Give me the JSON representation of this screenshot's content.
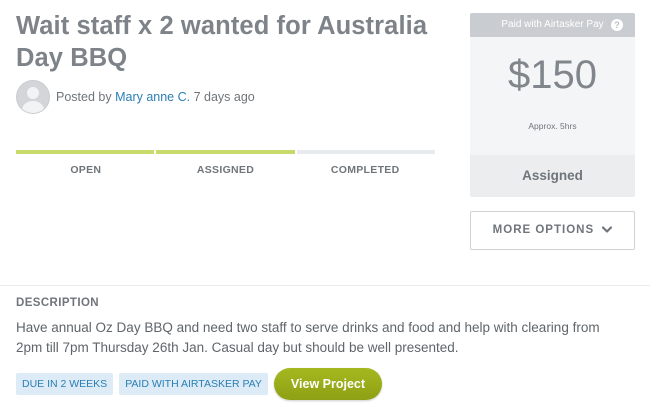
{
  "task": {
    "title": "Wait staff x 2 wanted for Australia Day BBQ",
    "posted_by_prefix": "Posted by",
    "poster_name": "Mary anne C.",
    "posted_when": "7 days ago"
  },
  "progress": {
    "stages": [
      "OPEN",
      "ASSIGNED",
      "COMPLETED"
    ],
    "completed_stages": 2,
    "accent_color": "#c9d96a"
  },
  "price_panel": {
    "pay_label": "Paid with Airtasker Pay",
    "info_icon": "info-icon",
    "price": "$150",
    "approx": "Approx. 5hrs",
    "status": "Assigned"
  },
  "more_options": {
    "label": "MORE OPTIONS",
    "icon": "chevron-down-icon"
  },
  "description": {
    "heading": "DESCRIPTION",
    "body": "Have annual Oz Day BBQ and need two staff to serve drinks and food and help with clearing from 2pm till 7pm Thursday 26th Jan. Casual day but should be well presented."
  },
  "tags": [
    "DUE IN 2 WEEKS",
    "PAID WITH AIRTASKER PAY"
  ],
  "actions": {
    "view_project": "View Project",
    "button_color": "#9aac1a"
  }
}
